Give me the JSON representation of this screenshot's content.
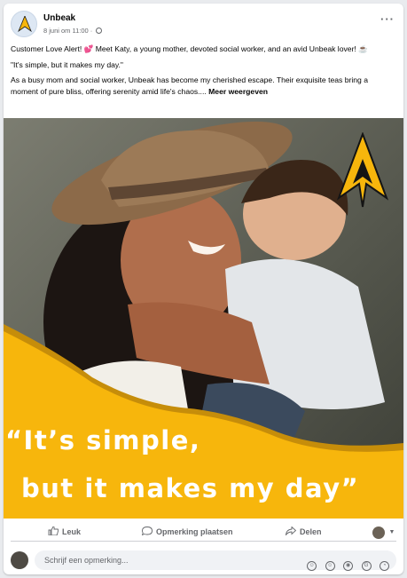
{
  "post": {
    "page_name": "Unbeak",
    "timestamp": "8 juni om 11:00 ·",
    "more_label": "···",
    "text_line1": "Customer Love Alert! 💕 Meet Katy, a young mother, devoted social worker, and an avid Unbeak lover! ☕",
    "text_line2": "\"It's simple, but it makes my day.\"",
    "text_line3": "As a busy mom and social worker, Unbeak has become my cherished escape. Their exquisite teas bring a moment of pure bliss, offering serenity amid life's chaos.... ",
    "see_more": "Meer weergeven"
  },
  "image": {
    "quote_line1": "“It’s simple,",
    "quote_line2": "but it makes my day”",
    "accent_color": "#f7b60c"
  },
  "actions": {
    "like": "Leuk",
    "comment": "Opmerking plaatsen",
    "share": "Delen"
  },
  "comment_box": {
    "placeholder": "Schrijf een opmerking..."
  },
  "colors": {
    "brand_yellow": "#f7b60c",
    "text_secondary": "#65676b"
  }
}
